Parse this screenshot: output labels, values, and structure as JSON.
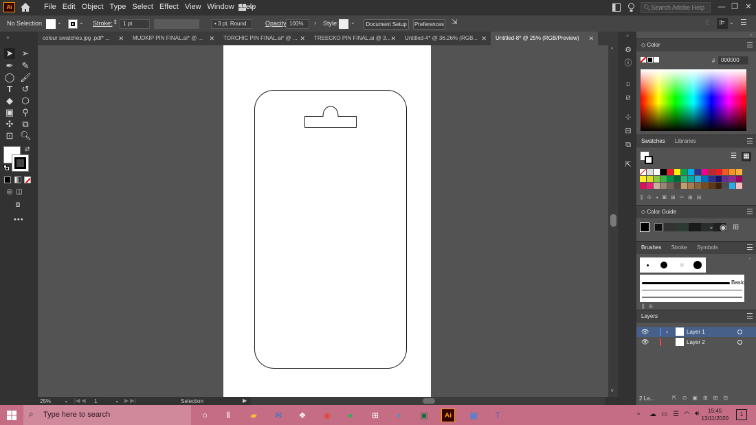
{
  "app": {
    "logo": "Ai",
    "menus": [
      "File",
      "Edit",
      "Object",
      "Type",
      "Select",
      "Effect",
      "View",
      "Window",
      "Help"
    ],
    "search_placeholder": "Search Adobe Help"
  },
  "control": {
    "selection": "No Selection",
    "stroke_label": "Stroke:",
    "stroke_weight": "1 pt",
    "brush": "3 pt. Round",
    "opacity_label": "Opacity:",
    "opacity_value": "100%",
    "style_label": "Style:",
    "doc_setup": "Document Setup",
    "preferences": "Preferences"
  },
  "tabs": [
    {
      "label": "colour swatches.jpg .pdf* ..."
    },
    {
      "label": "MUDKIP PIN FINAL.ai* @ ..."
    },
    {
      "label": "TORCHIC PIN FINAL.ai* @ ..."
    },
    {
      "label": "TREECKO PIN FINAL.ai @ 3..."
    },
    {
      "label": "Untitled-4* @ 36.26% (RGB..."
    },
    {
      "label": "Untitled-8* @ 25% (RGB/Preview)"
    }
  ],
  "status": {
    "zoom": "25%",
    "artboard": "1",
    "tool": "Selection"
  },
  "panels": {
    "color_title": "Color",
    "hex_symbol": "#",
    "hex_value": "000000",
    "swatches_tab": "Swatches",
    "libraries_tab": "Libraries",
    "color_guide_title": "Color Guide",
    "brushes_tab": "Brushes",
    "stroke_tab": "Stroke",
    "symbols_tab": "Symbols",
    "basic_label": "Basic",
    "layers_title": "Layers",
    "layers": [
      {
        "name": "Layer 1",
        "color": "#4f7fff"
      },
      {
        "name": "Layer 2",
        "color": "#ff3f3f"
      }
    ],
    "layers_count": "2 La..."
  },
  "colors": {
    "accent": "#ff9a00",
    "taskbar": "#c46d84"
  },
  "taskbar": {
    "search_placeholder": "Type here to search",
    "time": "15:45",
    "date": "13/11/2020",
    "notifications": "1"
  }
}
